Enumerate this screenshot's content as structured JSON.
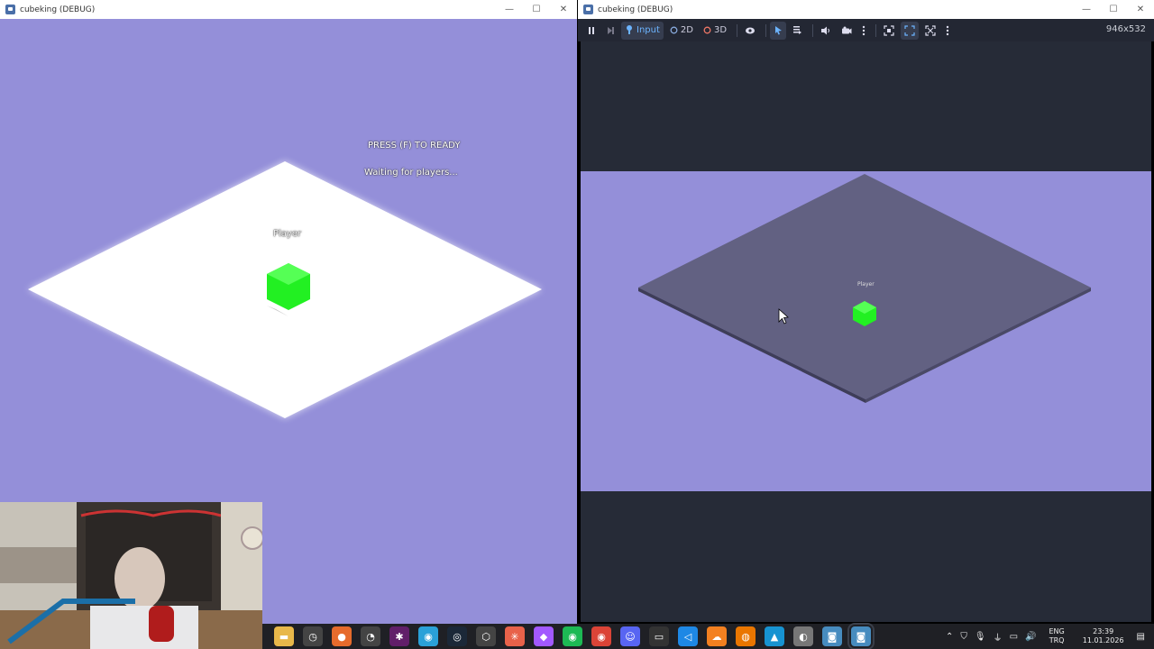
{
  "left_window": {
    "title": "cubeking (DEBUG)",
    "controls": {
      "minimize": "—",
      "maximize": "☐",
      "close": "✕"
    },
    "hud": {
      "ready_prompt": "PRESS (F) TO READY",
      "status": "Waiting for players..."
    },
    "player_label": "Player",
    "colors": {
      "background": "#948fd9",
      "floor": "#ffffff",
      "cube": "#33ee33"
    }
  },
  "right_window": {
    "title": "cubeking (DEBUG)",
    "controls": {
      "minimize": "—",
      "maximize": "☐",
      "close": "✕"
    },
    "toolbar": {
      "input_label": "Input",
      "mode_2d_label": "2D",
      "mode_3d_label": "3D",
      "resolution": "946x532"
    },
    "player_label": "Player",
    "colors": {
      "background": "#948fd9",
      "floor": "#626182",
      "letterbox": "#262b37",
      "cube": "#33ee33"
    }
  },
  "taskbar": {
    "apps": [
      {
        "name": "file-explorer-icon",
        "glyph": "▬",
        "color": "#e8b84a"
      },
      {
        "name": "clock-app-icon",
        "glyph": "◷",
        "color": "#444"
      },
      {
        "name": "firefox-icon",
        "glyph": "●",
        "color": "#e66b2c"
      },
      {
        "name": "speedometer-icon",
        "glyph": "◔",
        "color": "#444"
      },
      {
        "name": "slack-icon",
        "glyph": "✱",
        "color": "#611f69"
      },
      {
        "name": "lightbulb-icon",
        "glyph": "◉",
        "color": "#2aa1d8"
      },
      {
        "name": "steam-icon",
        "glyph": "◎",
        "color": "#1b2838"
      },
      {
        "name": "unity-icon",
        "glyph": "⬡",
        "color": "#444"
      },
      {
        "name": "asterisk-icon",
        "glyph": "✳",
        "color": "#e8624a"
      },
      {
        "name": "figma-icon",
        "glyph": "◆",
        "color": "#a259ff"
      },
      {
        "name": "spotify-icon",
        "glyph": "◉",
        "color": "#1db954"
      },
      {
        "name": "chrome-icon",
        "glyph": "◉",
        "color": "#db4437"
      },
      {
        "name": "discord-icon",
        "glyph": "☺",
        "color": "#5865f2"
      },
      {
        "name": "terminal-icon",
        "glyph": "▭",
        "color": "#333"
      },
      {
        "name": "vscode-icon",
        "glyph": "◁",
        "color": "#1e88e5"
      },
      {
        "name": "cloud-icon",
        "glyph": "☁",
        "color": "#f38020"
      },
      {
        "name": "blender-icon",
        "glyph": "◍",
        "color": "#ea7600"
      },
      {
        "name": "arch-icon",
        "glyph": "▲",
        "color": "#1793d1"
      },
      {
        "name": "app-icon",
        "glyph": "◐",
        "color": "#777"
      },
      {
        "name": "godot-icon",
        "glyph": "◙",
        "color": "#478cbf"
      },
      {
        "name": "godot-active-icon",
        "glyph": "◙",
        "color": "#478cbf"
      }
    ],
    "tray": {
      "language_top": "ENG",
      "language_bottom": "TRQ",
      "time": "23:39",
      "date": "11.01.2026"
    }
  }
}
